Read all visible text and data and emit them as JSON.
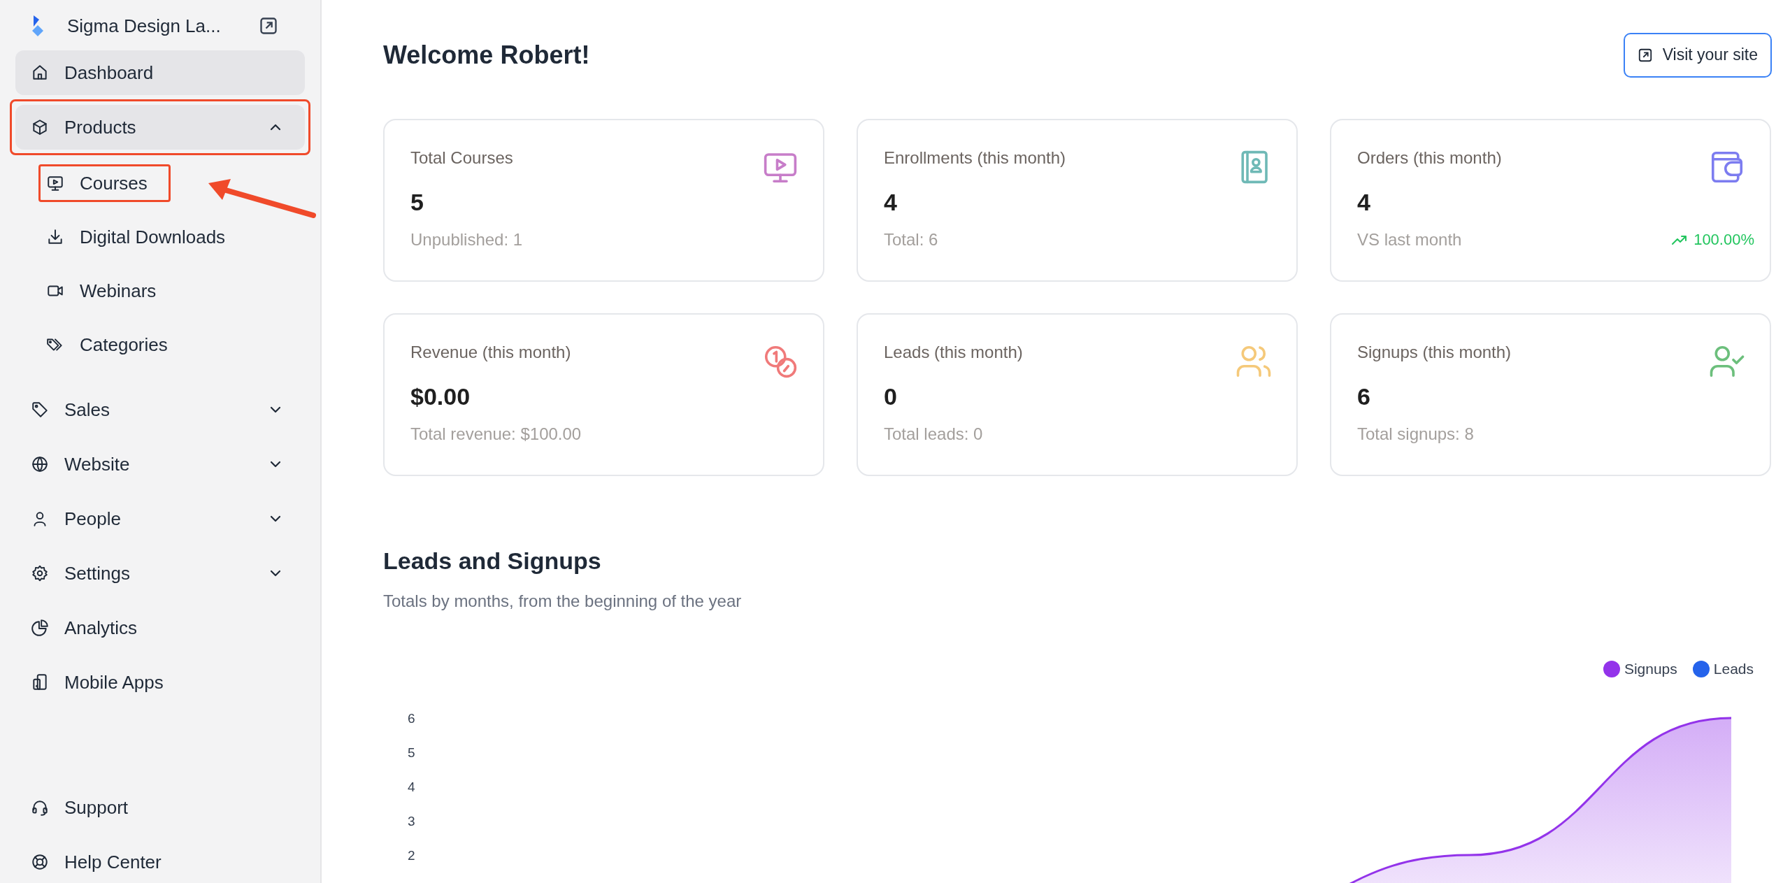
{
  "sidebar": {
    "brand": "Sigma Design La...",
    "items": [
      {
        "label": "Dashboard",
        "selected": true,
        "highlighted": false
      },
      {
        "label": "Products",
        "selected": true,
        "highlighted": true,
        "expanded": true,
        "children": [
          {
            "label": "Courses",
            "selected": false,
            "highlighted": true,
            "callout": true
          },
          {
            "label": "Digital Downloads",
            "selected": false,
            "highlighted": false,
            "callout": false
          },
          {
            "label": "Webinars",
            "selected": false,
            "highlighted": false,
            "callout": false
          },
          {
            "label": "Categories",
            "selected": false,
            "highlighted": false,
            "callout": false
          }
        ]
      },
      {
        "label": "Sales",
        "selected": false,
        "highlighted": false,
        "expanded": false
      },
      {
        "label": "Website",
        "selected": false,
        "highlighted": false,
        "expanded": false
      },
      {
        "label": "People",
        "selected": false,
        "highlighted": false,
        "expanded": false
      },
      {
        "label": "Settings",
        "selected": false,
        "highlighted": false,
        "expanded": false
      },
      {
        "label": "Analytics",
        "selected": false,
        "highlighted": false
      },
      {
        "label": "Mobile Apps",
        "selected": false,
        "highlighted": false
      }
    ],
    "footer_items": [
      {
        "label": "Support",
        "selected": false
      },
      {
        "label": "Help Center",
        "selected": false
      }
    ]
  },
  "header": {
    "title": "Welcome Robert!",
    "button": "Visit your site"
  },
  "stats": [
    {
      "title": "Total Courses",
      "value": "5",
      "note": "Unpublished: 1",
      "color": "#c77dc9"
    },
    {
      "title": "Enrollments (this month)",
      "value": "4",
      "note": "Total: 6",
      "color": "#6fb9b6"
    },
    {
      "title": "Orders (this month)",
      "value": "4",
      "note": "VS last month",
      "color": "#7c7cf0",
      "trend": "100.00%"
    },
    {
      "title": "Revenue (this month)",
      "value": "$0.00",
      "note": "Total revenue: $100.00",
      "color": "#f07a7a"
    },
    {
      "title": "Leads (this month)",
      "value": "0",
      "note": "Total leads: 0",
      "color": "#f5c97a"
    },
    {
      "title": "Signups (this month)",
      "value": "6",
      "note": "Total signups: 8",
      "color": "#6cbf7c"
    }
  ],
  "section": {
    "title": "Leads and Signups",
    "subtitle": "Totals by months, from the beginning of the year",
    "chart_data": {
      "type": "area",
      "ylim": [
        0,
        6
      ],
      "yticks": [
        2,
        3,
        4,
        5,
        6
      ],
      "series": [
        {
          "name": "Signups",
          "color": "#9333ea",
          "values": [
            0,
            0,
            0,
            0,
            2,
            6
          ]
        },
        {
          "name": "Leads",
          "color": "#2563eb"
        }
      ]
    }
  }
}
